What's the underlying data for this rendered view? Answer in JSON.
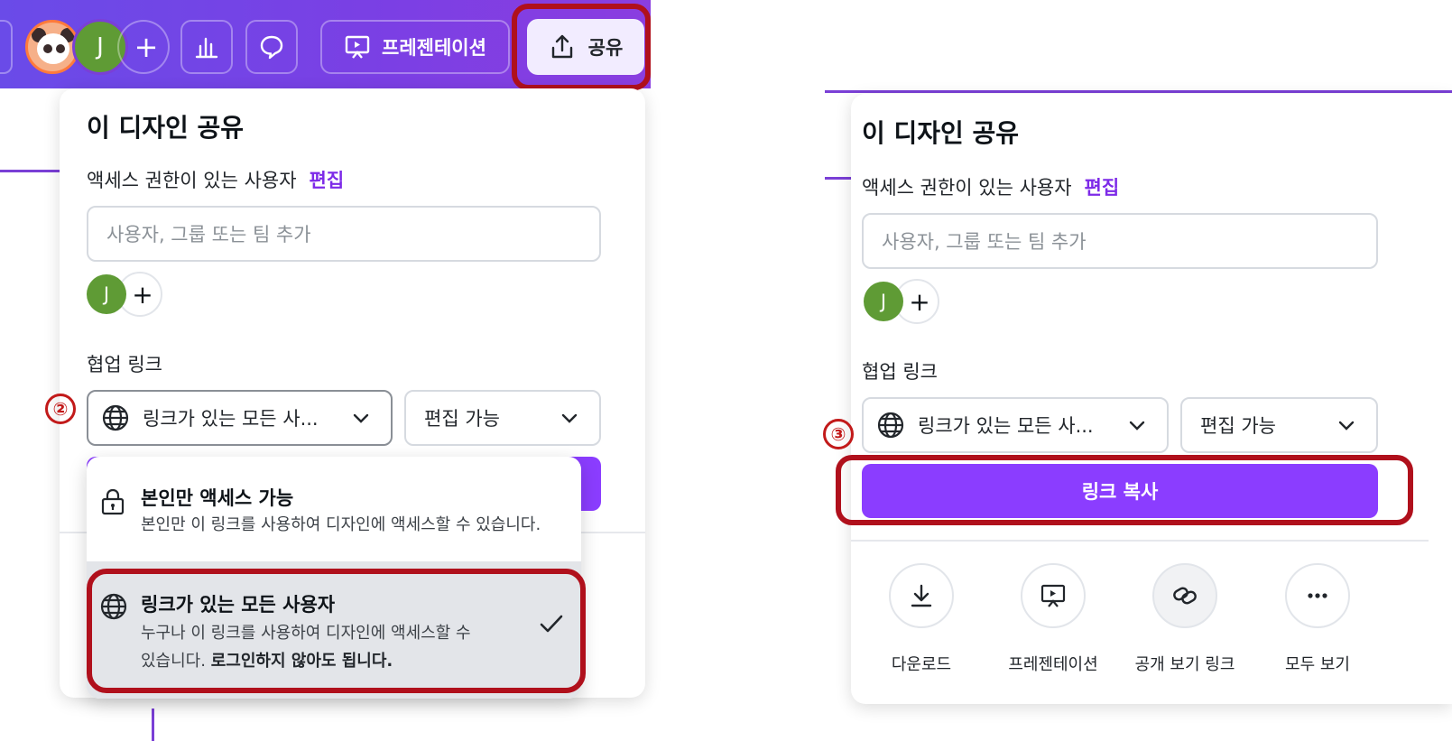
{
  "toolbar": {
    "avatar_initial": "J",
    "present_label": "프레젠테이션",
    "share_label": "공유"
  },
  "share_panel_left": {
    "title": "이 디자인 공유",
    "access_label": "액세스 권한이 있는 사용자",
    "edit_link": "편집",
    "add_placeholder": "사용자, 그룹 또는 팀 추가",
    "member_initial": "J",
    "collab_label": "협업 링크",
    "link_access_value": "링크가 있는 모든 사...",
    "permission_value": "편집 가능",
    "step_marker": "②"
  },
  "dropdown": {
    "option_private_title": "본인만 액세스 가능",
    "option_private_desc": "본인만 이 링크를 사용하여 디자인에 액세스할 수 있습니다.",
    "option_anyone_title": "링크가 있는 모든 사용자",
    "option_anyone_desc_1": "누구나 이 링크를 사용하여 디자인에 액세스할 수",
    "option_anyone_desc_2a": "있습니다.",
    "option_anyone_desc_2b": "로그인하지 않아도 됩니다."
  },
  "share_panel_right": {
    "title": "이 디자인 공유",
    "access_label": "액세스 권한이 있는 사용자",
    "edit_link": "편집",
    "add_placeholder": "사용자, 그룹 또는 팀 추가",
    "member_initial": "J",
    "collab_label": "협업 링크",
    "link_access_value": "링크가 있는 모든 사...",
    "permission_value": "편집 가능",
    "copy_link_label": "링크 복사",
    "step_marker": "③",
    "actions": [
      {
        "label": "다운로드",
        "icon": "download-icon"
      },
      {
        "label": "프레젠테이션",
        "icon": "present-icon"
      },
      {
        "label": "공개 보기 링크",
        "icon": "link-icon"
      },
      {
        "label": "모두 보기",
        "icon": "more-icon"
      }
    ]
  },
  "colors": {
    "brand_purple": "#8b3dff",
    "toolbar_gradient_start": "#6a4be8",
    "highlight_red": "#b0101c",
    "avatar_green": "#5f9b35"
  }
}
